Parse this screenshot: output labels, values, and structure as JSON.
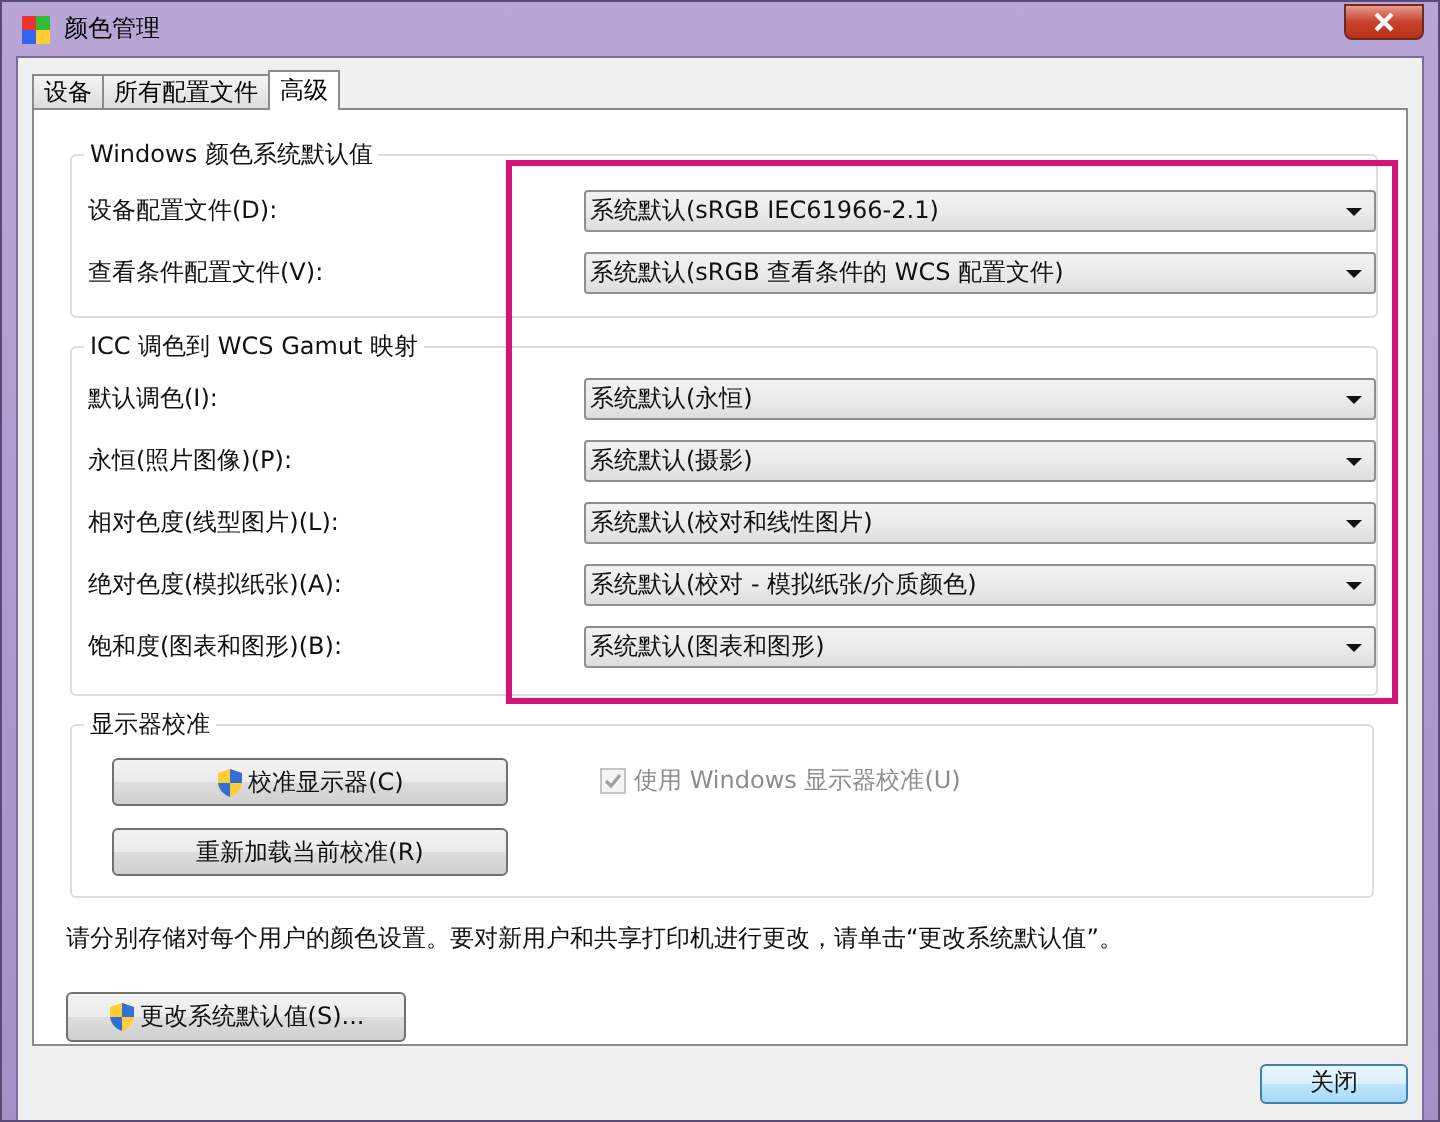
{
  "window": {
    "title": "颜色管理"
  },
  "tabs": [
    {
      "label": "设备",
      "selected": false
    },
    {
      "label": "所有配置文件",
      "selected": false
    },
    {
      "label": "高级",
      "selected": true
    }
  ],
  "groups": [
    {
      "title": "Windows 颜色系统默认值",
      "rows": [
        {
          "label": "设备配置文件(D):",
          "value": "系统默认(sRGB IEC61966-2.1)"
        },
        {
          "label": "查看条件配置文件(V):",
          "value": "系统默认(sRGB 查看条件的 WCS 配置文件)"
        }
      ]
    },
    {
      "title": "ICC 调色到 WCS Gamut 映射",
      "rows": [
        {
          "label": "默认调色(I):",
          "value": "系统默认(永恒)"
        },
        {
          "label": "永恒(照片图像)(P):",
          "value": "系统默认(摄影)"
        },
        {
          "label": "相对色度(线型图片)(L):",
          "value": "系统默认(校对和线性图片)"
        },
        {
          "label": "绝对色度(模拟纸张)(A):",
          "value": "系统默认(校对 - 模拟纸张/介质颜色)"
        },
        {
          "label": "饱和度(图表和图形)(B):",
          "value": "系统默认(图表和图形)"
        }
      ]
    }
  ],
  "calibration": {
    "title": "显示器校准",
    "buttons": [
      {
        "label": "校准显示器(C)",
        "shield": true
      },
      {
        "label": "重新加载当前校准(R)",
        "shield": false
      }
    ],
    "checkbox": {
      "label": "使用 Windows 显示器校准(U)",
      "checked": true,
      "disabled": true
    }
  },
  "note": "请分别存储对每个用户的颜色设置。要对新用户和共享打印机进行更改，请单击“更改系统默认值”。",
  "change_button": {
    "label": "更改系统默认值(S)...",
    "shield": true
  },
  "close_button": "关闭"
}
